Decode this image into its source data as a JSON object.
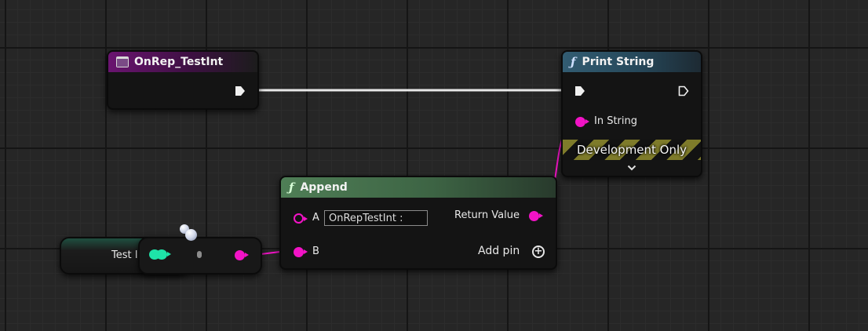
{
  "event_node": {
    "title": "OnRep_TestInt",
    "header_color": "#6a1470"
  },
  "print_node": {
    "title": "Print String",
    "in_string_label": "In String",
    "dev_only_label": "Development Only",
    "expand_glyph": "⌄",
    "header_color": "#325c72"
  },
  "append_node": {
    "title": "Append",
    "pin_a_label": "A",
    "pin_a_value": "OnRepTestInt :",
    "pin_b_label": "B",
    "return_label": "Return Value",
    "add_pin_label": "Add pin",
    "header_color": "#4f7e56"
  },
  "variable_node": {
    "label": "Test Int",
    "pin_color": "#1ee3a8"
  },
  "colors": {
    "exec_wire": "#e8e8e8",
    "string_pin": "#f213c6",
    "int_pin": "#1ee3a8"
  },
  "icons": {
    "function": "function-icon",
    "event": "event-icon",
    "add": "plus-circle-icon",
    "expand": "chevron-down-icon"
  }
}
